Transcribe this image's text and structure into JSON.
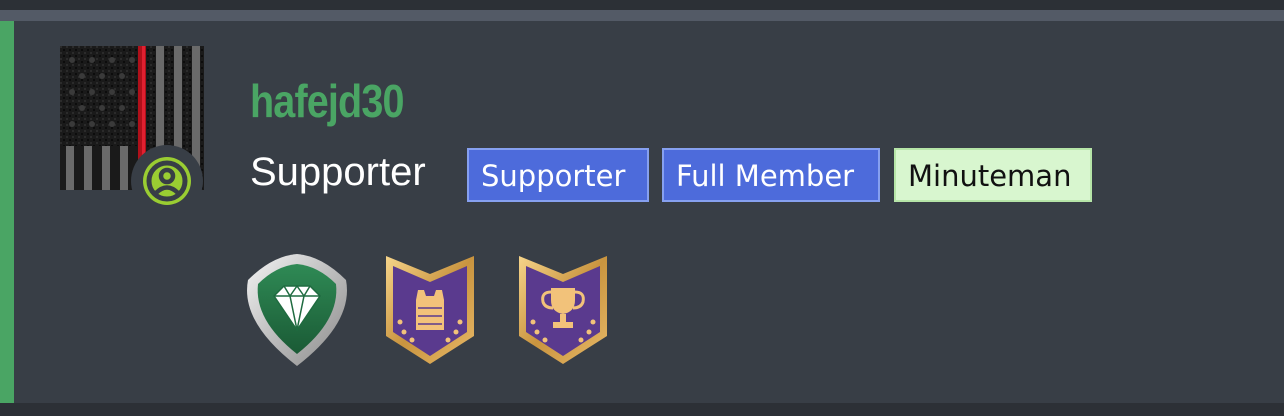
{
  "user": {
    "username": "hafejd30",
    "title": "Supporter"
  },
  "tags": [
    {
      "label": "Supporter",
      "style": "blue"
    },
    {
      "label": "Full Member",
      "style": "blue"
    },
    {
      "label": "Minuteman",
      "style": "green"
    }
  ],
  "trophies": [
    {
      "icon": "diamond-shield-icon"
    },
    {
      "icon": "body-armor-badge-icon"
    },
    {
      "icon": "trophy-cup-badge-icon"
    }
  ],
  "colors": {
    "accent": "#4aa564",
    "card_background": "#383e46",
    "tag_blue": "#4d6bdb",
    "tag_green": "#d8f6cf"
  }
}
